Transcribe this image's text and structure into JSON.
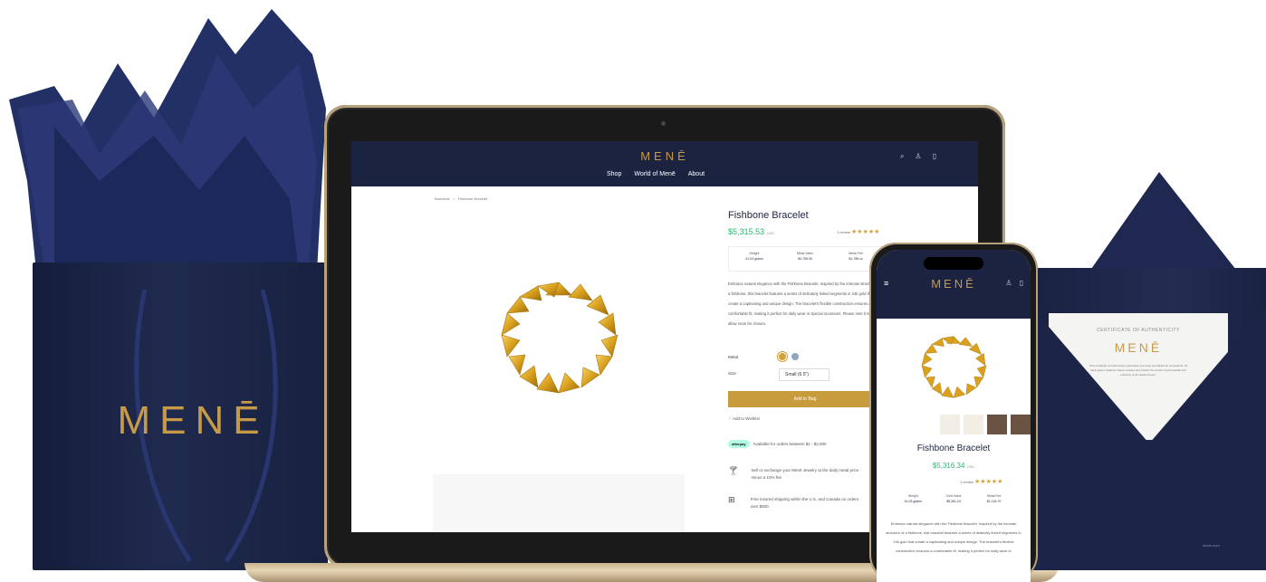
{
  "bag": {
    "logo": "MENĒ"
  },
  "laptop": {
    "site_logo": "MENĒ",
    "nav": [
      "Shop",
      "World of Menē",
      "About"
    ],
    "icons": [
      "search-icon",
      "account-icon",
      "bag-icon"
    ],
    "breadcrumb": [
      "Bracelets",
      "/",
      "Fishbone Bracelet"
    ],
    "product": {
      "title": "Fishbone Bracelet",
      "price": "$5,315.53",
      "currency": "USD",
      "reviews": "1 review",
      "stars": "★★★★★",
      "specs": [
        {
          "label": "Weight",
          "value": "41.03 grams"
        },
        {
          "label": "Metal Value",
          "value": "$4,795.30"
        },
        {
          "label": "Metal Fee",
          "value": "$1,755.xx"
        }
      ],
      "description": "Embrace natural elegance with the Fishbone Bracelet. Inspired by the intricate structure of a fishbone, this bracelet features a series of delicately linked segments in 24k gold that create a captivating and unique design. The bracelet's flexible construction ensures a comfortable fit, making it perfect for daily wear or special occasions. Please note 0.5\" up to allow room for closure.",
      "metal_label": "Metal",
      "size_label": "Size",
      "size_value": "Small (6.5\")",
      "add_to_bag": "Add to Bag",
      "wishlist": "♡ Add to Wishlist",
      "afterpay_badge": "afterpay",
      "afterpay_text": "Available for orders between $1 - $2,000",
      "perks": [
        {
          "icon": "martini-icon",
          "text": "Sell or exchange your Menē Jewelry at the daily metal price minus a 10% fee"
        },
        {
          "icon": "gift-icon",
          "text": "Free insured shipping within the U.S. and Canada on orders over $500."
        }
      ]
    }
  },
  "phone": {
    "logo": "MENĒ",
    "title": "Fishbone Bracelet",
    "price": "$5,316.34",
    "currency": "USD",
    "reviews": "1 review",
    "stars": "★★★★★",
    "specs": [
      {
        "label": "Weight",
        "value": "41.03 grams"
      },
      {
        "label": "Gold Value",
        "value": "$5,281.24"
      },
      {
        "label": "Metal Fee",
        "value": "$1,104.70"
      }
    ],
    "description": "Embrace natural elegance with the Fishbone Bracelet. Inspired by the intricate structure of a fishbone, this bracelet features a series of distinctly linked segments in 24k gold that create a captivating and unique design. The bracelet's flexible construction ensures a comfortable fit, making it perfect for daily wear or"
  },
  "certificate": {
    "title": "CERTIFICATE OF AUTHENTICITY",
    "logo": "MENĒ",
    "body": "This Certificate of Authenticity guarantees you have purchased an exceptional, 24 karat gold or platinum Menē creation and cherish the world's most beautiful and enduring of all metals forever.",
    "url": "mene.com"
  },
  "colors": {
    "navy": "#1b2340",
    "gold": "#c79a4a",
    "price_green": "#2bb673",
    "button_gold": "#c89b3c"
  }
}
